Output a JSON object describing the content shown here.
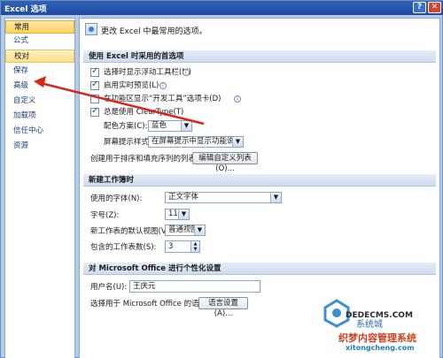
{
  "window": {
    "title": "Excel 选项",
    "help_glyph": "?",
    "close_glyph": "✕"
  },
  "nav": {
    "items": [
      {
        "label": "常用"
      },
      {
        "label": "公式"
      },
      {
        "label": "校对"
      },
      {
        "label": "保存"
      },
      {
        "label": "高级"
      },
      {
        "label": "自定义"
      },
      {
        "label": "加载项"
      },
      {
        "label": "信任中心"
      },
      {
        "label": "资源"
      }
    ]
  },
  "main": {
    "intro": "更改 Excel 中最常用的选项。",
    "section1": {
      "title": "使用 Excel 时采用的首选项",
      "checkboxes": [
        {
          "label": "选择时显示浮动工具栏(M)",
          "checked": true
        },
        {
          "label": "启用实时预览(L)",
          "checked": true
        },
        {
          "label": "在功能区显示“开发工具”选项卡(D)",
          "checked": false
        },
        {
          "label": "总是使用 ClearType(T)",
          "checked": true
        }
      ],
      "color_label": "配色方案(C):",
      "color_value": "蓝色",
      "tip_label": "屏幕提示样式(R):",
      "tip_value": "在屏幕提示中显示功能说明",
      "custom_list_label": "创建用于排序和填充序列的列表:",
      "custom_list_button": "编辑自定义列表(O)..."
    },
    "section2": {
      "title": "新建工作簿时",
      "font_label": "使用的字体(N):",
      "font_value": "正文字体",
      "size_label": "字号(Z):",
      "size_value": "11",
      "view_label": "新工作表的默认视图(V):",
      "view_value": "普通视图",
      "sheets_label": "包含的工作表数(S):",
      "sheets_value": "3"
    },
    "section3": {
      "title": "对 Microsoft Office 进行个性化设置",
      "user_label": "用户名(U):",
      "user_value": "王庆元",
      "lang_label": "选择用于 Microsoft Office 的语言:",
      "lang_button": "语言设置(A)..."
    }
  },
  "watermark": {
    "site": "DEDECMS.COM",
    "line1": "织梦内容管理系统",
    "line2": "xitongcheng.com",
    "brand": "系统城"
  },
  "colors": {
    "accent": "#d6261c",
    "title_bar": "#2f63b8",
    "nav_selected": "#ffd25e"
  }
}
